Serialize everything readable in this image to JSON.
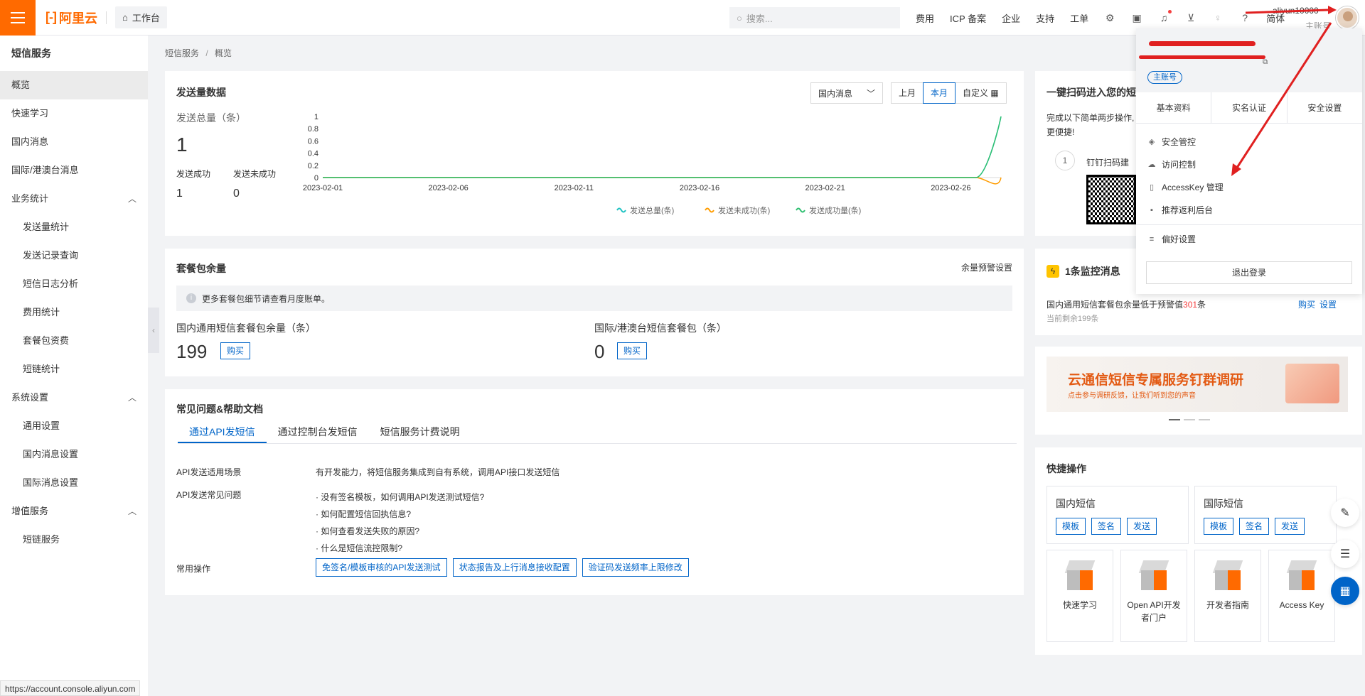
{
  "topbar": {
    "logo": "阿里云",
    "workbench": "工作台",
    "search_placeholder": "搜索...",
    "links": [
      "费用",
      "ICP 备案",
      "企业",
      "支持",
      "工单"
    ],
    "lang": "简体",
    "account_name": "aliyun10000",
    "account_sub": "主账号"
  },
  "sidebar": {
    "title": "短信服务",
    "items": [
      {
        "label": "概览"
      },
      {
        "label": "快速学习"
      },
      {
        "label": "国内消息"
      },
      {
        "label": "国际/港澳台消息"
      },
      {
        "label": "业务统计"
      },
      {
        "label": "发送量统计"
      },
      {
        "label": "发送记录查询"
      },
      {
        "label": "短信日志分析"
      },
      {
        "label": "费用统计"
      },
      {
        "label": "套餐包资费"
      },
      {
        "label": "短链统计"
      },
      {
        "label": "系统设置"
      },
      {
        "label": "通用设置"
      },
      {
        "label": "国内消息设置"
      },
      {
        "label": "国际消息设置"
      },
      {
        "label": "增值服务"
      },
      {
        "label": "短链服务"
      }
    ],
    "status_url": "https://account.console.aliyun.com"
  },
  "breadcrumb": {
    "root": "短信服务",
    "sep": "/",
    "current": "概览"
  },
  "send_card": {
    "title": "发送量数据",
    "select": "国内消息",
    "segments": [
      "上月",
      "本月",
      "自定义"
    ],
    "total_label": "发送总量（条）",
    "total_value": "1",
    "success_label": "发送成功",
    "success_value": "1",
    "fail_label": "发送未成功",
    "fail_value": "0"
  },
  "chart_data": {
    "type": "line",
    "x": [
      "2023-02-01",
      "2023-02-02",
      "2023-02-03",
      "2023-02-04",
      "2023-02-05",
      "2023-02-06",
      "2023-02-07",
      "2023-02-08",
      "2023-02-09",
      "2023-02-10",
      "2023-02-11",
      "2023-02-12",
      "2023-02-13",
      "2023-02-14",
      "2023-02-15",
      "2023-02-16",
      "2023-02-17",
      "2023-02-18",
      "2023-02-19",
      "2023-02-20",
      "2023-02-21",
      "2023-02-22",
      "2023-02-23",
      "2023-02-24",
      "2023-02-25",
      "2023-02-26",
      "2023-02-27",
      "2023-02-28"
    ],
    "xticks": [
      "2023-02-01",
      "2023-02-06",
      "2023-02-11",
      "2023-02-16",
      "2023-02-21",
      "2023-02-26"
    ],
    "yticks": [
      "0",
      "0.2",
      "0.4",
      "0.6",
      "0.8",
      "1"
    ],
    "ylim": [
      0,
      1
    ],
    "series": [
      {
        "name": "发送总量(条)",
        "color": "#1fc2c2",
        "values": [
          0,
          0,
          0,
          0,
          0,
          0,
          0,
          0,
          0,
          0,
          0,
          0,
          0,
          0,
          0,
          0,
          0,
          0,
          0,
          0,
          0,
          0,
          0,
          0,
          0,
          0,
          0,
          1
        ]
      },
      {
        "name": "发送未成功(条)",
        "color": "#ff9c00",
        "values": [
          0,
          0,
          0,
          0,
          0,
          0,
          0,
          0,
          0,
          0,
          0,
          0,
          0,
          0,
          0,
          0,
          0,
          0,
          0,
          0,
          0,
          0,
          0,
          0,
          0,
          0,
          0,
          0
        ]
      },
      {
        "name": "发送成功量(条)",
        "color": "#2fbf71",
        "values": [
          0,
          0,
          0,
          0,
          0,
          0,
          0,
          0,
          0,
          0,
          0,
          0,
          0,
          0,
          0,
          0,
          0,
          0,
          0,
          0,
          0,
          0,
          0,
          0,
          0,
          0,
          0,
          1
        ]
      }
    ]
  },
  "package_card": {
    "title": "套餐包余量",
    "alert_settings": "余量预警设置",
    "notice": "更多套餐包细节请查看月度账单。",
    "domestic_label": "国内通用短信套餐包余量（条）",
    "domestic_value": "199",
    "intl_label": "国际/港澳台短信套餐包（条）",
    "intl_value": "0",
    "buy": "购买"
  },
  "faq_card": {
    "title": "常见问题&帮助文档",
    "tabs": [
      "通过API发短信",
      "通过控制台发短信",
      "短信服务计费说明"
    ],
    "scene_label": "API发送适用场景",
    "scene_text": "有开发能力，将短信服务集成到自有系统，调用API接口发送短信",
    "faq_label": "API发送常见问题",
    "faqs": [
      "没有签名模板，如何调用API发送测试短信?",
      "如何配置短信回执信息?",
      "如何查看发送失败的原因?",
      "什么是短信流控限制?"
    ],
    "ops_label": "常用操作",
    "ops": [
      "免签名/模板审核的API发送测试",
      "状态报告及上行消息接收配置",
      "验证码发送频率上限修改"
    ]
  },
  "right": {
    "scan_title": "一键扫码进入您的短",
    "scan_desc1": "完成以下简单两步操作,",
    "scan_desc2": "更便捷!",
    "step_num": "1",
    "step_text": "钉钉扫码建",
    "monitor_title": "1条监控消息",
    "monitor_text_pre": "国内通用短信套餐包余量低于预警值",
    "monitor_num": "301",
    "monitor_text_post": "条",
    "monitor_sub": "当前剩余199条",
    "monitor_buy": "购买",
    "monitor_set": "设置",
    "banner_title": "云通信短信专属服务钉群调研",
    "banner_sub": "点击参与调研反馈，让我们听到您的声音",
    "quick_title": "快捷操作",
    "domestic": "国内短信",
    "intl": "国际短信",
    "btns": [
      "模板",
      "签名",
      "发送"
    ],
    "tiles": [
      "快速学习",
      "Open API开发者门户",
      "开发者指南",
      "Access Key"
    ]
  },
  "dropdown": {
    "badge": "主账号",
    "tabs": [
      "基本资料",
      "实名认证",
      "安全设置"
    ],
    "items": [
      "安全管控",
      "访问控制",
      "AccessKey 管理",
      "推荐返利后台",
      "偏好设置"
    ],
    "logout": "退出登录"
  },
  "colors": {
    "brand": "#ff6a00",
    "primary": "#0064c8",
    "alert_red": "#f53f3f"
  }
}
